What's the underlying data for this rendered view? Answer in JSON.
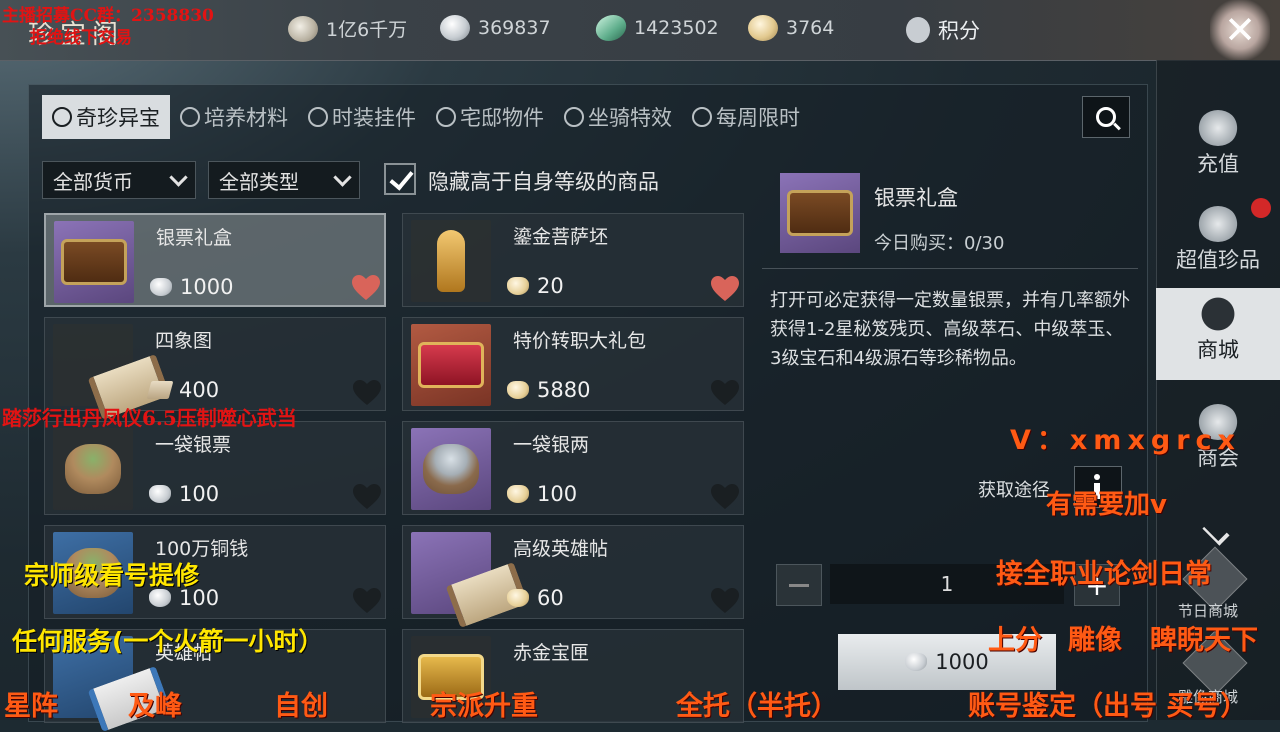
{
  "header": {
    "title": "珍宝阁",
    "currencies": [
      {
        "icon": "coin-icon",
        "value": "1亿6千万"
      },
      {
        "icon": "silver-note-icon",
        "value": "369837"
      },
      {
        "icon": "jade-icon",
        "value": "1423502"
      },
      {
        "icon": "gold-ingot-icon",
        "value": "3764"
      },
      {
        "icon": "points-shield-icon",
        "value": "积分"
      }
    ]
  },
  "tabs": [
    {
      "label": "奇珍异宝",
      "active": true
    },
    {
      "label": "培养材料"
    },
    {
      "label": "时装挂件"
    },
    {
      "label": "宅邸物件"
    },
    {
      "label": "坐骑特效"
    },
    {
      "label": "每周限时"
    }
  ],
  "filters": {
    "currency": "全部货币",
    "type": "全部类型",
    "hide_label": "隐藏高于自身等级的商品"
  },
  "items": [
    {
      "name": "银票礼盒",
      "price": "1000",
      "price_icon": "silver-note-icon",
      "favorite": true
    },
    {
      "name": "鎏金菩萨坯",
      "price": "20",
      "price_icon": "gold-ingot-icon",
      "favorite": true
    },
    {
      "name": "四象图",
      "price": "400",
      "price_icon": "wood-icon",
      "favorite": false
    },
    {
      "name": "特价转职大礼包",
      "price": "5880",
      "price_icon": "gold-ingot-icon",
      "favorite": false
    },
    {
      "name": "一袋银票",
      "price": "100",
      "price_icon": "silver-note-icon",
      "favorite": false
    },
    {
      "name": "一袋银两",
      "price": "100",
      "price_icon": "gold-ingot-icon",
      "favorite": false
    },
    {
      "name": "100万铜钱",
      "price": "100",
      "price_icon": "silver-note-icon",
      "favorite": false
    },
    {
      "name": "高级英雄帖",
      "price": "60",
      "price_icon": "gold-ingot-icon",
      "favorite": false
    },
    {
      "name": "英雄帖",
      "price": "",
      "price_icon": "silver-note-icon",
      "favorite": false
    },
    {
      "name": "赤金宝匣",
      "price": "",
      "price_icon": "gold-ingot-icon",
      "favorite": false
    }
  ],
  "detail": {
    "name": "银票礼盒",
    "limit": "今日购买：0/30",
    "description": "打开可必定获得一定数量银票，并有几率额外获得1-2星秘笈残页、高级萃石、中级萃玉、3级宝石和4级源石等珍稀物品。",
    "source_label": "获取途径",
    "quantity": "1",
    "buy_price": "1000"
  },
  "sidebar": [
    {
      "label": "充值",
      "icon": "money-bag-icon"
    },
    {
      "label": "超值珍品",
      "icon": "pavilion-icon",
      "badge": true
    },
    {
      "label": "商城",
      "icon": "shop-icon",
      "active": true
    },
    {
      "label": "商会",
      "icon": "guild-icon"
    }
  ],
  "sidebar_extra": {
    "festival1": "节日商城",
    "festival2": "雕像商城"
  },
  "overlay": {
    "tl1": "主播招募CC群：2358830",
    "tl2": "拒绝线下交易",
    "left_red": "踏莎行出丹凤仪6.5压制噬心武当",
    "wechat": "V：xmxgrcx",
    "need": "有需要加v",
    "all_class": "接全职业论剑日常",
    "services": [
      "上分",
      "雕像",
      "睥睨天下"
    ],
    "master": "宗师级看号提修",
    "any_service": "任何服务(一个火箭一小时）",
    "bottom": [
      "星阵",
      "及峰",
      "自创",
      "宗派升重",
      "全托（半托）",
      "账号鉴定（出号 买号）"
    ]
  }
}
